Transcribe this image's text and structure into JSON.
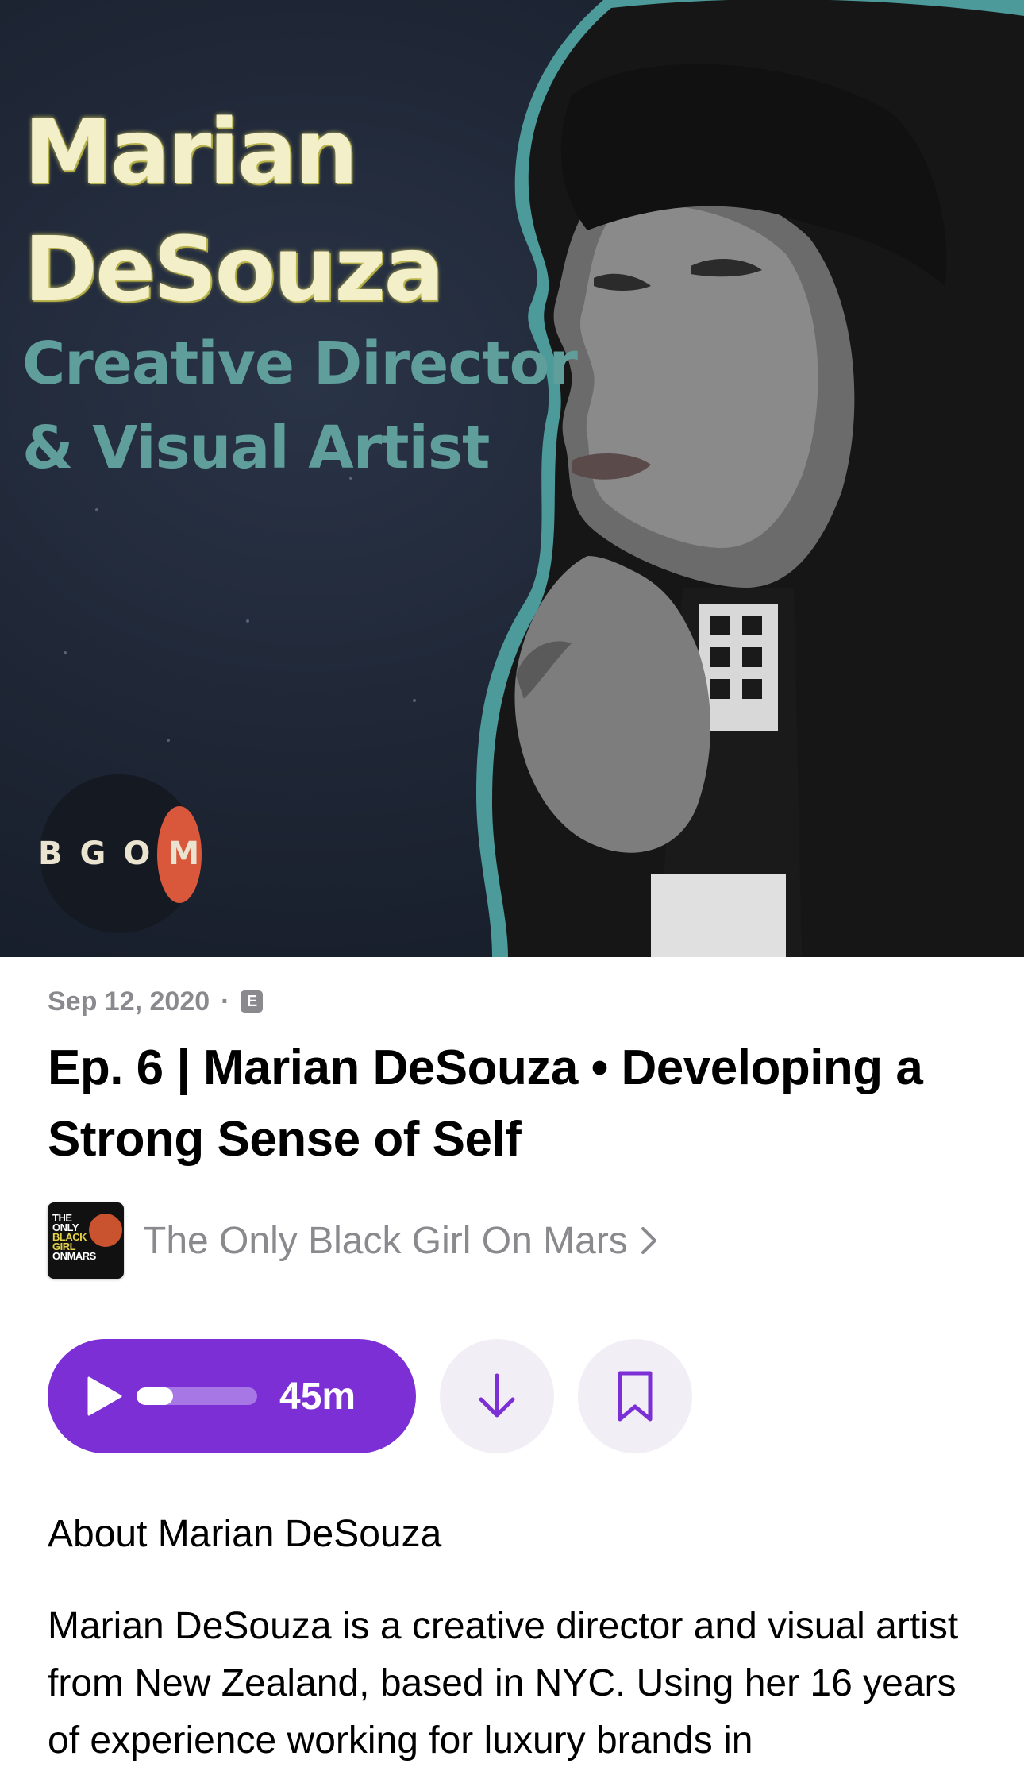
{
  "artwork": {
    "name": "Marian\nDeSouza",
    "role": "Creative Director\n& Visual Artist",
    "logo_text": "BGOM"
  },
  "episode": {
    "date": "Sep 12, 2020",
    "separator": "·",
    "explicit_badge": "E",
    "title": "Ep. 6 | Marian DeSouza • Developing a Strong Sense of Self"
  },
  "show": {
    "name": "The Only Black Girl On Mars",
    "thumb_text_top": "THE\nONLY",
    "thumb_text_mid": "BLACK\nGIRL",
    "thumb_text_bottom": "ONMARS"
  },
  "controls": {
    "duration": "45m",
    "progress": 0.3
  },
  "about": {
    "heading": "About Marian DeSouza",
    "description": "Marian DeSouza is a creative director and visual artist from New Zealand, based in NYC. Using her 16 years of experience working for luxury brands in"
  },
  "colors": {
    "accent": "#7b2fd4",
    "secondary_text": "#8a8a8e",
    "circle_button_bg": "#f1eef5"
  },
  "icons": {
    "play": "play-icon",
    "download": "arrow-down-icon",
    "bookmark": "bookmark-icon",
    "chevron": "chevron-right-icon"
  }
}
